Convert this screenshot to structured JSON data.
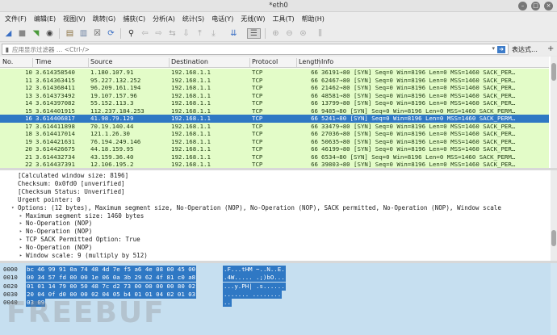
{
  "window": {
    "title": "*eth0"
  },
  "menu": [
    "文件(F)",
    "编辑(E)",
    "视图(V)",
    "跳转(G)",
    "捕获(C)",
    "分析(A)",
    "统计(S)",
    "电话(Y)",
    "无线(W)",
    "工具(T)",
    "帮助(H)"
  ],
  "filter": {
    "placeholder": "应用显示过滤器 … <Ctrl-/>",
    "expression": "表达式…",
    "plus": "+"
  },
  "columns": {
    "no": "No.",
    "time": "Time",
    "source": "Source",
    "destination": "Destination",
    "protocol": "Protocol",
    "length": "Length",
    "info": "Info"
  },
  "packets": [
    {
      "no": "10",
      "time": "3.614358540",
      "src": "1.180.107.91",
      "dst": "192.168.1.1",
      "proto": "TCP",
      "len": "66",
      "info": "36191→80 [SYN] Seq=0 Win=8196 Len=0 MSS=1460 SACK_PER…"
    },
    {
      "no": "11",
      "time": "3.614363415",
      "src": "95.227.132.252",
      "dst": "192.168.1.1",
      "proto": "TCP",
      "len": "66",
      "info": "62467→80 [SYN] Seq=0 Win=8196 Len=0 MSS=1460 SACK_PER…"
    },
    {
      "no": "12",
      "time": "3.614368411",
      "src": "96.209.161.194",
      "dst": "192.168.1.1",
      "proto": "TCP",
      "len": "66",
      "info": "21462→80 [SYN] Seq=0 Win=8196 Len=0 MSS=1460 SACK_PER…"
    },
    {
      "no": "13",
      "time": "3.614373492",
      "src": "19.107.157.96",
      "dst": "192.168.1.1",
      "proto": "TCP",
      "len": "66",
      "info": "48581→80 [SYN] Seq=0 Win=8196 Len=0 MSS=1460 SACK_PER…"
    },
    {
      "no": "14",
      "time": "3.614397082",
      "src": "55.152.113.3",
      "dst": "192.168.1.1",
      "proto": "TCP",
      "len": "66",
      "info": "13799→80 [SYN] Seq=0 Win=8196 Len=0 MSS=1460 SACK_PER…"
    },
    {
      "no": "15",
      "time": "3.614401915",
      "src": "112.237.184.253",
      "dst": "192.168.1.1",
      "proto": "TCP",
      "len": "66",
      "info": "9485→80 [SYN] Seq=0 Win=8196 Len=0 MSS=1460 SACK_PERM…"
    },
    {
      "no": "16",
      "time": "3.614406817",
      "src": "41.98.79.129",
      "dst": "192.168.1.1",
      "proto": "TCP",
      "len": "66",
      "info": "5241→80 [SYN] Seq=0 Win=8196 Len=0 MSS=1460 SACK_PERM…",
      "selected": true
    },
    {
      "no": "17",
      "time": "3.614411898",
      "src": "70.19.140.44",
      "dst": "192.168.1.1",
      "proto": "TCP",
      "len": "66",
      "info": "33479→80 [SYN] Seq=0 Win=8196 Len=0 MSS=1460 SACK_PER…"
    },
    {
      "no": "18",
      "time": "3.614417014",
      "src": "121.1.26.30",
      "dst": "192.168.1.1",
      "proto": "TCP",
      "len": "66",
      "info": "27036→80 [SYN] Seq=0 Win=8196 Len=0 MSS=1460 SACK_PER…"
    },
    {
      "no": "19",
      "time": "3.614421631",
      "src": "76.194.249.146",
      "dst": "192.168.1.1",
      "proto": "TCP",
      "len": "66",
      "info": "50635→80 [SYN] Seq=0 Win=8196 Len=0 MSS=1460 SACK_PER…"
    },
    {
      "no": "20",
      "time": "3.614426675",
      "src": "44.18.159.95",
      "dst": "192.168.1.1",
      "proto": "TCP",
      "len": "66",
      "info": "46199→80 [SYN] Seq=0 Win=8196 Len=0 MSS=1460 SACK_PER…"
    },
    {
      "no": "21",
      "time": "3.614432734",
      "src": "43.159.36.40",
      "dst": "192.168.1.1",
      "proto": "TCP",
      "len": "66",
      "info": "6534→80 [SYN] Seq=0 Win=8196 Len=0 MSS=1460 SACK_PERM…"
    },
    {
      "no": "22",
      "time": "3.614437391",
      "src": "12.106.195.2",
      "dst": "192.168.1.1",
      "proto": "TCP",
      "len": "66",
      "info": "39803→80 [SYN] Seq=0 Win=8196 Len=0 MSS=1460 SACK_PER…"
    }
  ],
  "details": [
    {
      "text": "[Calculated window size: 8196]",
      "indent": 1,
      "twisty": ""
    },
    {
      "text": "Checksum: 0x0fd0 [unverified]",
      "indent": 1,
      "twisty": ""
    },
    {
      "text": "[Checksum Status: Unverified]",
      "indent": 1,
      "twisty": ""
    },
    {
      "text": "Urgent pointer: 0",
      "indent": 1,
      "twisty": ""
    },
    {
      "text": "Options: (12 bytes), Maximum segment size, No-Operation (NOP), No-Operation (NOP), SACK permitted, No-Operation (NOP), Window scale",
      "indent": 1,
      "twisty": "▾"
    },
    {
      "text": "Maximum segment size: 1460 bytes",
      "indent": 2,
      "twisty": "▸"
    },
    {
      "text": "No-Operation (NOP)",
      "indent": 2,
      "twisty": "▸"
    },
    {
      "text": "No-Operation (NOP)",
      "indent": 2,
      "twisty": "▸"
    },
    {
      "text": "TCP SACK Permitted Option: True",
      "indent": 2,
      "twisty": "▸"
    },
    {
      "text": "No-Operation (NOP)",
      "indent": 2,
      "twisty": "▸"
    },
    {
      "text": "Window scale: 9 (multiply by 512)",
      "indent": 2,
      "twisty": "▸"
    }
  ],
  "bytes": [
    {
      "off": "0000",
      "hex": "bc 46 99 91 0a 74 48 4d  7e f5 a6 4e 08 00 45 00",
      "ascii": ".F...tHM ~..N..E."
    },
    {
      "off": "0010",
      "hex": "00 34 57 fd 00 00 1e 06  0a 3b 29 62 4f 81 c0 a8",
      "ascii": ".4W..... .;)bO..."
    },
    {
      "off": "0020",
      "hex": "01 01 14 79 00 50 48 7c  d2 73 00 00 00 00 80 02",
      "ascii": "...y.PH| .s......"
    },
    {
      "off": "0030",
      "hex": "20 04 0f d0 00 00 02 04  05 b4 01 01 04 02 01 03",
      "ascii": " ....... ........"
    },
    {
      "off": "0040",
      "hex": "03 09",
      "ascii": ".."
    }
  ],
  "watermark": "FREEBUF"
}
